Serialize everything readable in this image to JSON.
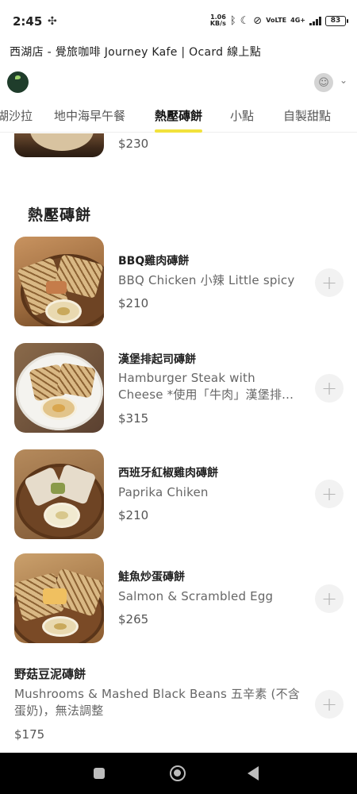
{
  "status_bar": {
    "time": "2:45",
    "speed_value": "1.06",
    "speed_unit": "KB/s",
    "battery": "83",
    "network": "4G+"
  },
  "page_title": "西湖店 - 覺旅咖啡 Journey Kafe | Ocard 線上點",
  "tabs": [
    {
      "label": "湖沙拉"
    },
    {
      "label": "地中海早午餐"
    },
    {
      "label": "熱壓磚餅"
    },
    {
      "label": "小點"
    },
    {
      "label": "自製甜點"
    }
  ],
  "active_tab": "熱壓磚餅",
  "previous_item": {
    "price": "$230"
  },
  "section": {
    "title": "熱壓磚餅"
  },
  "items": [
    {
      "name": "BBQ雞肉磚餅",
      "description": "BBQ Chicken 小辣 Little spicy",
      "price": "$210",
      "add_label": "+"
    },
    {
      "name": "漢堡排起司磚餅",
      "description": "Hamburger Steak with Cheese *使用「牛肉」漢堡排...",
      "price": "$315",
      "add_label": "+"
    },
    {
      "name": "西班牙紅椒雞肉磚餅",
      "description": "Paprika Chiken",
      "price": "$210",
      "add_label": "+"
    },
    {
      "name": "鮭魚炒蛋磚餅",
      "description": "Salmon & Scrambled Egg",
      "price": "$265",
      "add_label": "+"
    },
    {
      "name": "野菇豆泥磚餅",
      "description": "Mushrooms & Mashed Black Beans 五辛素 (不含蛋奶)，無法調整",
      "price": "$175",
      "add_label": "+"
    }
  ],
  "colors": {
    "tab_underline": "#f2e23c",
    "nav_bar": "#000000"
  },
  "icons": [
    "fan-icon",
    "bluetooth-icon",
    "moon-icon",
    "dnd-icon",
    "volte-icon",
    "signal-icon",
    "battery-icon",
    "avatar-icon",
    "chevron-down-icon",
    "plus-icon",
    "recents-icon",
    "home-icon",
    "back-icon"
  ]
}
